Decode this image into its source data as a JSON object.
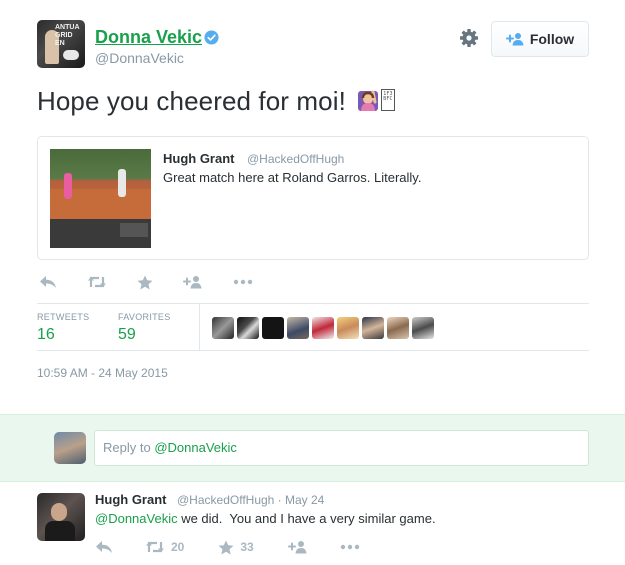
{
  "tweet": {
    "author_name": "Donna Vekic",
    "author_handle": "@DonnaVekic",
    "avatar_text": "ANTUA\nGRID\nEN",
    "follow_label": "Follow",
    "text": "Hope you cheered for moi!",
    "emoji_box_text": "1F3\nBFC",
    "quoted": {
      "author_name": "Hugh Grant",
      "author_handle": "@HackedOffHugh",
      "text": "Great match here at Roland Garros. Literally."
    },
    "stats": {
      "retweets_label": "RETWEETS",
      "retweets_count": "16",
      "favorites_label": "FAVORITES",
      "favorites_count": "59"
    },
    "timestamp": "10:59 AM - 24 May 2015"
  },
  "reply_box": {
    "prefix": "Reply to ",
    "mention": "@DonnaVekic"
  },
  "reply_tweet": {
    "author_name": "Hugh Grant",
    "meta": "@HackedOffHugh · May 24",
    "mention": "@DonnaVekic",
    "text": " we did.  You and I have a very similar game.",
    "retweet_count": "20",
    "favorite_count": "33"
  },
  "colors": {
    "accent_green": "#19a04b",
    "muted": "#8899a6",
    "icon_gray": "#aab8c2",
    "reply_bg": "#eaf7ef",
    "verified_blue": "#55acee"
  },
  "icons": [
    "verified-icon",
    "gear-icon",
    "add-user-icon",
    "reply-icon",
    "retweet-icon",
    "favorite-icon",
    "follow-icon",
    "more-icon"
  ]
}
